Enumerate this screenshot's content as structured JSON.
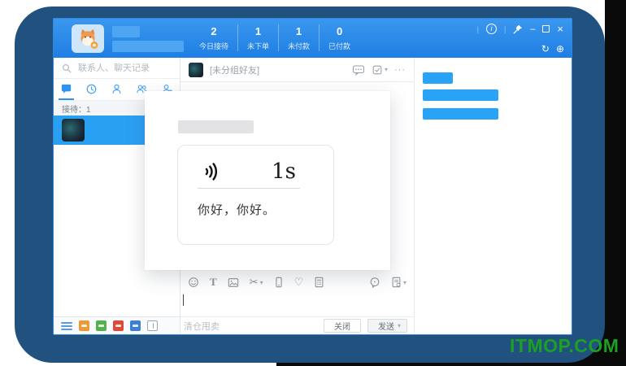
{
  "colors": {
    "frame_navy": "#20517f",
    "header_blue_top": "#3b97ee",
    "header_blue_bottom": "#1e7ee3",
    "selected_chat_blue": "#2aa0f3",
    "redact_blue": "#29a3f5",
    "watermark_green": "#1ca022"
  },
  "page": {
    "watermark": "ITMOP.COM"
  },
  "header": {
    "stats": [
      {
        "value": "2",
        "label": "今日接待"
      },
      {
        "value": "1",
        "label": "未下单"
      },
      {
        "value": "1",
        "label": "未付款"
      },
      {
        "value": "0",
        "label": "已付款"
      }
    ],
    "controls": {
      "info": "i",
      "minimize": "–",
      "close": "×",
      "separator": "|"
    },
    "refresh": "↻",
    "plus": "⊕"
  },
  "sidebar": {
    "search_placeholder": "联系人、聊天记录",
    "reception_label": "接待：1"
  },
  "chat": {
    "title": "[未分组好友]",
    "toolbar": {
      "text_tool": "T",
      "scissors": "✂",
      "heart": "♡",
      "caret_down": "▾",
      "more": "···"
    },
    "draft_text": "清仓甩卖",
    "close_button": "关闭",
    "send_button": "发送"
  },
  "popup": {
    "duration": "1s",
    "message": "你好，你好。"
  }
}
